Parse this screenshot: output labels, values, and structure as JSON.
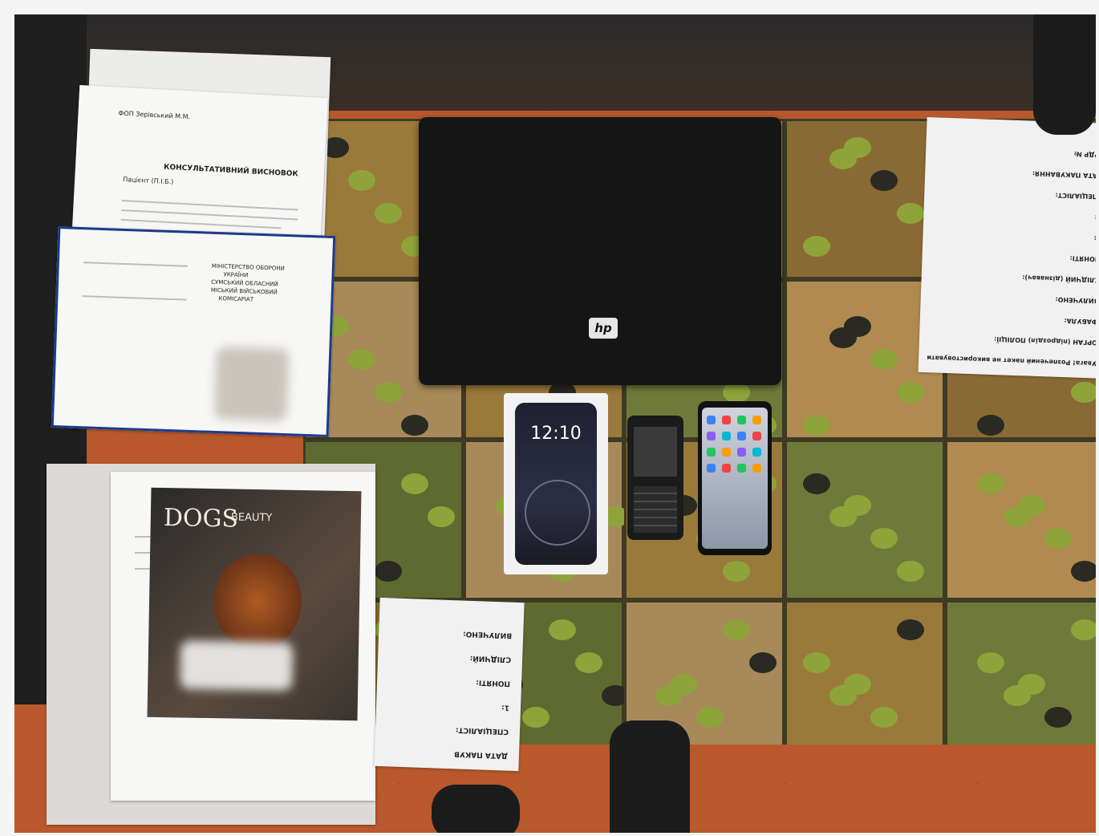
{
  "scene": {
    "description_tags": [
      "seized-items",
      "table",
      "documents",
      "laptop",
      "phones"
    ]
  },
  "consult_doc": {
    "header": "ФОП Зерівський М.М.",
    "title": "КОНСУЛЬТАТИВНИЙ ВИСНОВОК",
    "patient": "Пацієнт (П.І.Б.)"
  },
  "military_card": {
    "line1": "МІНІСТЕРСТВО ОБОРОНИ",
    "line2": "УКРАЇНИ",
    "line3": "СУМСЬКИЙ ОБЛАСНИЙ",
    "line4": "МІСЬКИЙ ВІЙСЬКОВИЙ",
    "line5": "КОМІСАРІАТ"
  },
  "laptop": {
    "brand": "hp"
  },
  "iphone_box": {
    "time": "12:10"
  },
  "dogs_magazine": {
    "title": "DOGS",
    "subtitle": "BEAUTY"
  },
  "envelope_right": {
    "lines": [
      "Увага! Розпечений пакет не використовувати",
      "ОРГАН (підрозділ) ПОЛІЦІЇ:",
      "ФАБУЛА:",
      "ВИЛУЧЕНО:",
      "СЛІДЧИЙ (дізнавач):",
      "ПОНЯТІ:",
      "1:",
      "2:",
      "СПЕЦІАЛІСТ:",
      "ДАТА ПАКУВАННЯ:",
      "ЄРДР №"
    ]
  },
  "envelope_bottom": {
    "lines": [
      "ДАТА ПАКУВ",
      "СПЕЦІАЛІСТ:",
      "1:",
      "ПОНЯТІ:",
      "СЛІДЧИЙ:",
      "ВИЛУЧЕНО:"
    ]
  },
  "colors": {
    "floor": "#b8582c",
    "tablecloth": "#7a5a2a",
    "laptop": "#151515",
    "olive_green": "#8ea43a",
    "olive_dark": "#2a2a22"
  }
}
